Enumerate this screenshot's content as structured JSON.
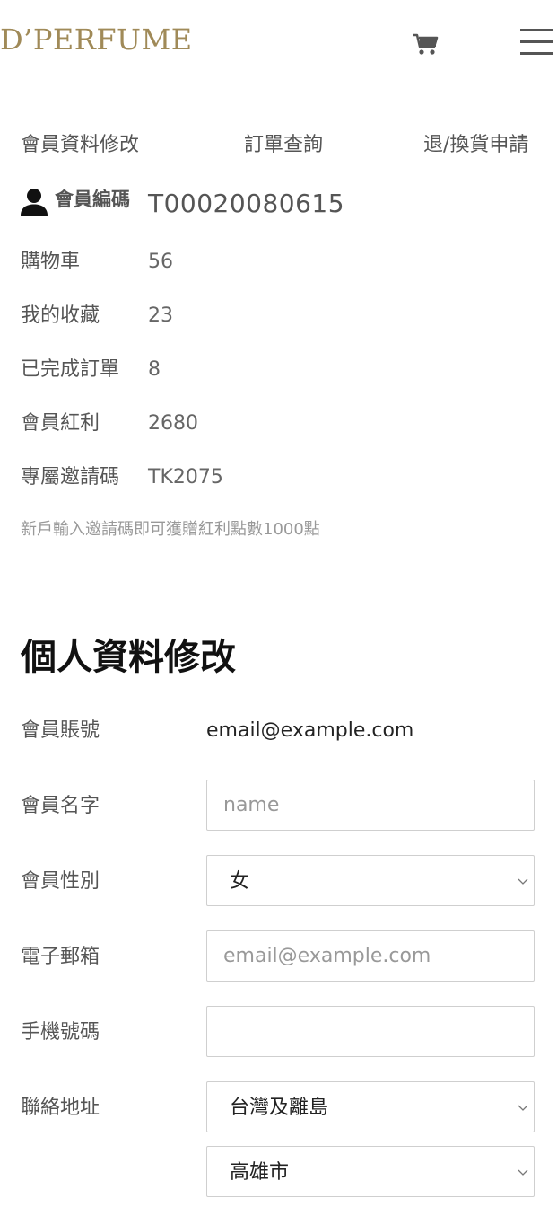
{
  "header": {
    "logo_text": "D’PERFUME",
    "cart_icon": "cart-icon",
    "menu_icon": "hamburger-menu-icon"
  },
  "tabs": [
    {
      "label": "會員資料修改"
    },
    {
      "label": "訂單查詢"
    },
    {
      "label": "退/換貨申請"
    }
  ],
  "member": {
    "id_label": "會員編碼",
    "id_value": "T00020080615",
    "stats": [
      {
        "label": "購物車",
        "value": "56"
      },
      {
        "label": "我的收藏",
        "value": "23"
      },
      {
        "label": "已完成訂單",
        "value": "8"
      },
      {
        "label": "會員紅利",
        "value": "2680"
      },
      {
        "label": "專屬邀請碼",
        "value": "TK2075"
      }
    ],
    "note": "新戶輸入邀請碼即可獲贈紅利點數1000點"
  },
  "form": {
    "title": "個人資料修改",
    "account_label": "會員賬號",
    "account_value": "email@example.com",
    "name_label": "會員名字",
    "name_placeholder": "name",
    "gender_label": "會員性別",
    "gender_value": "女",
    "email_label": "電子郵箱",
    "email_placeholder": "email@example.com",
    "phone_label": "手機號碼",
    "phone_placeholder": "",
    "address_label": "聯絡地址",
    "region_value": "台灣及離島",
    "city_value": "高雄市"
  },
  "colors": {
    "brand_gold": "#a08a58",
    "text_gray": "#555555",
    "note_gray": "#999999"
  }
}
